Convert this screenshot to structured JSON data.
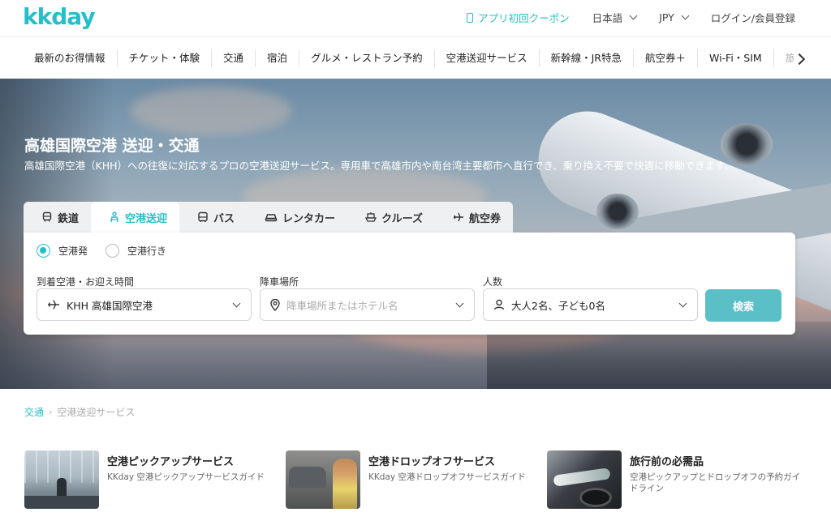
{
  "header": {
    "logo": "kkday",
    "coupon": "アプリ初回クーポン",
    "language": "日本語",
    "currency": "JPY",
    "login": "ログイン/会員登録"
  },
  "nav": {
    "items": [
      "最新のお得情報",
      "チケット・体験",
      "交通",
      "宿泊",
      "グルメ・レストラン予約",
      "空港送迎サービス",
      "新幹線・JR特急",
      "航空券＋",
      "Wi-Fi・SIM",
      "旅"
    ]
  },
  "hero": {
    "title": "高雄国際空港 送迎・交通",
    "description": "高雄国際空港（KHH）への往復に対応するプロの空港送迎サービス。専用車で高雄市内や南台湾主要都市へ直行でき、乗り換え不要で快適に移動できます。"
  },
  "tabs": [
    {
      "label": "鉄道",
      "icon": "train-icon",
      "active": false
    },
    {
      "label": "空港送迎",
      "icon": "airport-transfer-icon",
      "active": true
    },
    {
      "label": "バス",
      "icon": "bus-icon",
      "active": false
    },
    {
      "label": "レンタカー",
      "icon": "car-icon",
      "active": false
    },
    {
      "label": "クルーズ",
      "icon": "cruise-icon",
      "active": false
    },
    {
      "label": "航空券",
      "icon": "plane-icon",
      "active": false
    }
  ],
  "search": {
    "radio_from": "空港発",
    "radio_to": "空港行き",
    "radio_selected": "空港発",
    "airport_label": "到着空港・お迎え時間",
    "airport_value": "KHH 高雄国際空港",
    "dropoff_label": "降車場所",
    "dropoff_placeholder": "降車場所またはホテル名",
    "pax_label": "人数",
    "pax_value": "大人2名、子ども0名",
    "button": "検索"
  },
  "breadcrumb": {
    "link": "交通",
    "current": "空港送迎サービス"
  },
  "cards": [
    {
      "title": "空港ピックアップサービス",
      "subtitle": "KKday 空港ピックアップサービスガイド"
    },
    {
      "title": "空港ドロップオフサービス",
      "subtitle": "KKday 空港ドロップオフサービスガイド"
    },
    {
      "title": "旅行前の必需品",
      "subtitle": "空港ピックアップとドロップオフの予約ガイドライン"
    }
  ],
  "colors": {
    "brand": "#26bec9",
    "search_button": "#5bbfc8"
  }
}
